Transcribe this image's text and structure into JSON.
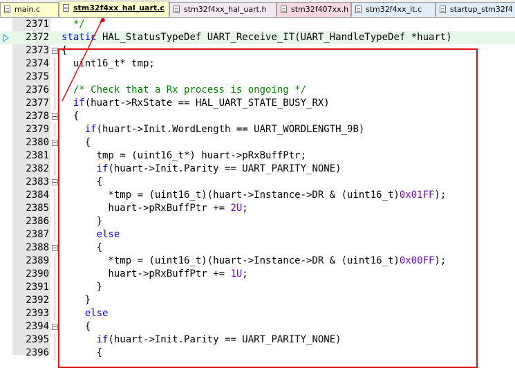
{
  "tabs": [
    {
      "label": "main.c",
      "bg": "#ffffcc",
      "active": false
    },
    {
      "label": "stm32f4xx_hal_uart.c",
      "bg": "#ffffcc",
      "active": true
    },
    {
      "label": "stm32f4xx_hal_uart.h",
      "bg": "#f4e8f4",
      "active": false
    },
    {
      "label": "stm32f407xx.h",
      "bg": "#f8d8e0",
      "active": false
    },
    {
      "label": "stm32f4xx_it.c",
      "bg": "#e0ecf8",
      "active": false
    },
    {
      "label": "startup_stm32f4",
      "bg": "#e0ecf8",
      "active": false
    }
  ],
  "colors": {
    "keyword": "#0000ff",
    "comment": "#008000",
    "number": "#6a0dad",
    "highlight_box": "#e01010",
    "current_line": "#e8f8e8"
  },
  "editor": {
    "lines": [
      {
        "n": "2371",
        "fold": false,
        "tokens": [
          {
            "t": "  ",
            "c": ""
          },
          {
            "t": "*/",
            "c": "cm"
          }
        ]
      },
      {
        "n": "2372",
        "fold": false,
        "current": true,
        "tokens": [
          {
            "t": "static",
            "c": "kw"
          },
          {
            "t": " HAL_StatusTypeDef UART_Receive_IT(UART_HandleTypeDef *huart)",
            "c": ""
          }
        ]
      },
      {
        "n": "2373",
        "fold": true,
        "tokens": [
          {
            "t": "{",
            "c": ""
          }
        ]
      },
      {
        "n": "2374",
        "fold": false,
        "tokens": [
          {
            "t": "  uint16_t* tmp;",
            "c": ""
          }
        ]
      },
      {
        "n": "2375",
        "fold": false,
        "tokens": []
      },
      {
        "n": "2376",
        "fold": false,
        "tokens": [
          {
            "t": "  ",
            "c": ""
          },
          {
            "t": "/* Check that a Rx process is ongoing */",
            "c": "cm"
          }
        ]
      },
      {
        "n": "2377",
        "fold": false,
        "tokens": [
          {
            "t": "  ",
            "c": ""
          },
          {
            "t": "if",
            "c": "kw"
          },
          {
            "t": "(huart->RxState == HAL_UART_STATE_BUSY_RX)",
            "c": ""
          }
        ]
      },
      {
        "n": "2378",
        "fold": true,
        "tokens": [
          {
            "t": "  {",
            "c": ""
          }
        ]
      },
      {
        "n": "2379",
        "fold": false,
        "tokens": [
          {
            "t": "    ",
            "c": ""
          },
          {
            "t": "if",
            "c": "kw"
          },
          {
            "t": "(huart->Init.WordLength == UART_WORDLENGTH_9B)",
            "c": ""
          }
        ]
      },
      {
        "n": "2380",
        "fold": true,
        "tokens": [
          {
            "t": "    {",
            "c": ""
          }
        ]
      },
      {
        "n": "2381",
        "fold": false,
        "tokens": [
          {
            "t": "      tmp = (uint16_t*) huart->pRxBuffPtr;",
            "c": ""
          }
        ]
      },
      {
        "n": "2382",
        "fold": false,
        "tokens": [
          {
            "t": "      ",
            "c": ""
          },
          {
            "t": "if",
            "c": "kw"
          },
          {
            "t": "(huart->Init.Parity == UART_PARITY_NONE)",
            "c": ""
          }
        ]
      },
      {
        "n": "2383",
        "fold": true,
        "tokens": [
          {
            "t": "      {",
            "c": ""
          }
        ]
      },
      {
        "n": "2384",
        "fold": false,
        "tokens": [
          {
            "t": "        *tmp = (uint16_t)(huart->Instance->DR & (uint16_t)",
            "c": ""
          },
          {
            "t": "0x01FF",
            "c": "num"
          },
          {
            "t": ");",
            "c": ""
          }
        ]
      },
      {
        "n": "2385",
        "fold": false,
        "tokens": [
          {
            "t": "        huart->pRxBuffPtr += ",
            "c": ""
          },
          {
            "t": "2U",
            "c": "num"
          },
          {
            "t": ";",
            "c": ""
          }
        ]
      },
      {
        "n": "2386",
        "fold": false,
        "tokens": [
          {
            "t": "      }",
            "c": ""
          }
        ]
      },
      {
        "n": "2387",
        "fold": false,
        "tokens": [
          {
            "t": "      ",
            "c": ""
          },
          {
            "t": "else",
            "c": "kw"
          }
        ]
      },
      {
        "n": "2388",
        "fold": true,
        "tokens": [
          {
            "t": "      {",
            "c": ""
          }
        ]
      },
      {
        "n": "2389",
        "fold": false,
        "tokens": [
          {
            "t": "        *tmp = (uint16_t)(huart->Instance->DR & (uint16_t)",
            "c": ""
          },
          {
            "t": "0x00FF",
            "c": "num"
          },
          {
            "t": ");",
            "c": ""
          }
        ]
      },
      {
        "n": "2390",
        "fold": false,
        "tokens": [
          {
            "t": "        huart->pRxBuffPtr += ",
            "c": ""
          },
          {
            "t": "1U",
            "c": "num"
          },
          {
            "t": ";",
            "c": ""
          }
        ]
      },
      {
        "n": "2391",
        "fold": false,
        "tokens": [
          {
            "t": "      }",
            "c": ""
          }
        ]
      },
      {
        "n": "2392",
        "fold": false,
        "tokens": [
          {
            "t": "    }",
            "c": ""
          }
        ]
      },
      {
        "n": "2393",
        "fold": false,
        "tokens": [
          {
            "t": "    ",
            "c": ""
          },
          {
            "t": "else",
            "c": "kw"
          }
        ]
      },
      {
        "n": "2394",
        "fold": true,
        "tokens": [
          {
            "t": "    {",
            "c": ""
          }
        ]
      },
      {
        "n": "2395",
        "fold": false,
        "tokens": [
          {
            "t": "      ",
            "c": ""
          },
          {
            "t": "if",
            "c": "kw"
          },
          {
            "t": "(huart->Init.Parity == UART_PARITY_NONE)",
            "c": ""
          }
        ]
      },
      {
        "n": "2396",
        "fold": false,
        "tokens": [
          {
            "t": "      {",
            "c": ""
          }
        ]
      }
    ]
  }
}
